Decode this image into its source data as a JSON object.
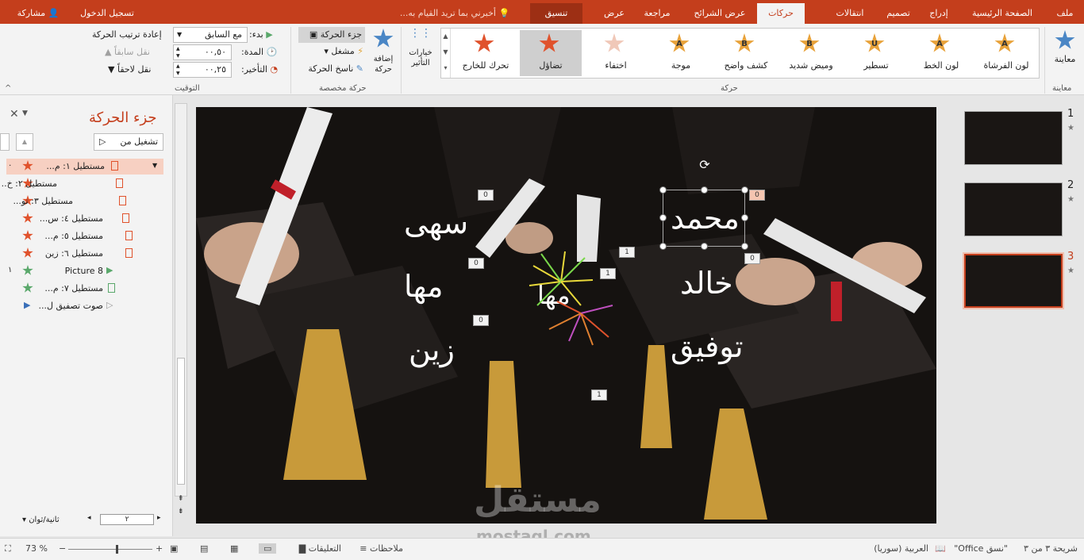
{
  "titlebar": {
    "file": "ملف",
    "tabs": [
      "الصفحة الرئيسية",
      "إدراج",
      "تصميم",
      "انتقالات",
      "حركات",
      "عرض الشرائح",
      "مراجعة",
      "عرض"
    ],
    "context_tab": "تنسيق",
    "tell_me": "أخبرني بما تريد القيام به...",
    "sign_in": "تسجيل الدخول",
    "share": "مشاركة"
  },
  "ribbon": {
    "preview": {
      "button": "معاينة",
      "group": "معاينة"
    },
    "animation_gallery": [
      {
        "label": "لون الفرشاة",
        "letter": "A"
      },
      {
        "label": "لون الخط",
        "letter": "A"
      },
      {
        "label": "تسطير",
        "letter": "U"
      },
      {
        "label": "وميض شديد",
        "letter": "B"
      },
      {
        "label": "كشف واضح",
        "letter": "B"
      },
      {
        "label": "موجة",
        "letter": "A"
      },
      {
        "label": "اختفاء",
        "letter": ""
      },
      {
        "label": "تضاؤل",
        "letter": ""
      },
      {
        "label": "تحرك للخارج",
        "letter": ""
      }
    ],
    "animation_group": "حركة",
    "effect_options": "خيارات التأثير",
    "add_animation": "إضافة حركة",
    "animation_pane": "جزء الحركة",
    "trigger": "مشغل",
    "painter": "ناسخ الحركة",
    "advanced_group": "حركة مخصصة",
    "start_label": "بدء:",
    "start_value": "مع السابق",
    "duration_label": "المدة:",
    "duration_value": "٠٠,٥٠",
    "delay_label": "التأخير:",
    "delay_value": "٠٠,٢٥",
    "reorder_title": "إعادة ترتيب الحركة",
    "move_earlier": "نقل سابقاً",
    "move_later": "نقل لاحقاً",
    "timing_group": "التوقيت"
  },
  "anim_pane": {
    "title": "جزء الحركة",
    "play_from": "تشغيل من",
    "items": [
      {
        "label": "مستطيل ١: م...",
        "num": "٠",
        "icon": "star-red"
      },
      {
        "label": "مستطيل ٢: خ...",
        "num": "",
        "icon": "star-red"
      },
      {
        "label": "مستطيل ٣: تو...",
        "num": "",
        "icon": "star-red"
      },
      {
        "label": "مستطيل ٤: س...",
        "num": "",
        "icon": "star-red"
      },
      {
        "label": "مستطيل ٥: م...",
        "num": "",
        "icon": "star-red"
      },
      {
        "label": "مستطيل ٦: زين",
        "num": "",
        "icon": "star-red"
      },
      {
        "label": "Picture 8",
        "num": "١",
        "icon": "star-green"
      },
      {
        "label": "مستطيل ٧: م...",
        "num": "",
        "icon": "star-green"
      },
      {
        "label": "صوت تصفيق ل...",
        "num": "",
        "icon": "play"
      }
    ],
    "seconds": "ثانية/ثوان",
    "zoom_val": "٢"
  },
  "slide": {
    "names_left": [
      "سهى",
      "مها",
      "زين"
    ],
    "names_right": [
      "محمد",
      "خالد",
      "توفيق"
    ],
    "center_name": "مها",
    "tags": [
      "0",
      "0",
      "0",
      "1",
      "1",
      "0",
      "0",
      "1"
    ]
  },
  "thumbnails": [
    {
      "num": "1"
    },
    {
      "num": "2"
    },
    {
      "num": "3"
    }
  ],
  "watermark": {
    "ar": "مستقل",
    "en": "mostaql.com"
  },
  "status": {
    "slide_info": "شريحة ٣ من ٣",
    "theme": "\"نسق Office\"",
    "language": "العربية (سوريا)",
    "notes": "ملاحظات",
    "comments": "التعليقات",
    "zoom": "73 %"
  },
  "colors": {
    "accent": "#c43e1c",
    "ribbon": "#f3f3f3",
    "slide_bg": "#151210"
  }
}
